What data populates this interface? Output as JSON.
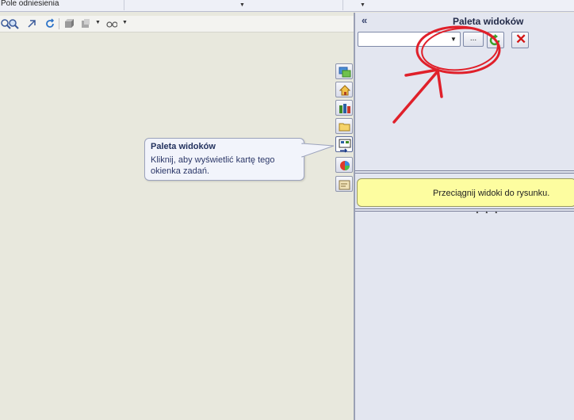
{
  "top_bar": {
    "field_label": "Pole odniesienia"
  },
  "toolbar": {
    "icons": [
      "zoom-area-icon",
      "zoom-icon",
      "rotate-icon",
      "refresh-icon",
      "view-cube-icon",
      "display-style-icon",
      "hide-show-icon"
    ]
  },
  "side_tabs": [
    {
      "name": "feature-manager-icon"
    },
    {
      "name": "home-icon"
    },
    {
      "name": "resources-icon"
    },
    {
      "name": "folder-icon"
    },
    {
      "name": "view-palette-icon",
      "active": true
    },
    {
      "name": "appearance-icon"
    },
    {
      "name": "custom-properties-icon"
    }
  ],
  "tooltip": {
    "title": "Paleta widoków",
    "body": "Kliknij, aby wyświetlić kartę tego okienka zadań."
  },
  "panel": {
    "collapse_glyph": "«",
    "title": "Paleta widoków",
    "combo_value": "",
    "browse_label": "...",
    "close_glyph": "✕",
    "hint": "Przeciągnij widoki do rysunku."
  },
  "colors": {
    "annotation": "#e0202a",
    "hint_bg": "#fdfda0",
    "panel_bg": "#e3e6f0",
    "canvas_bg": "#e8e8dd"
  }
}
